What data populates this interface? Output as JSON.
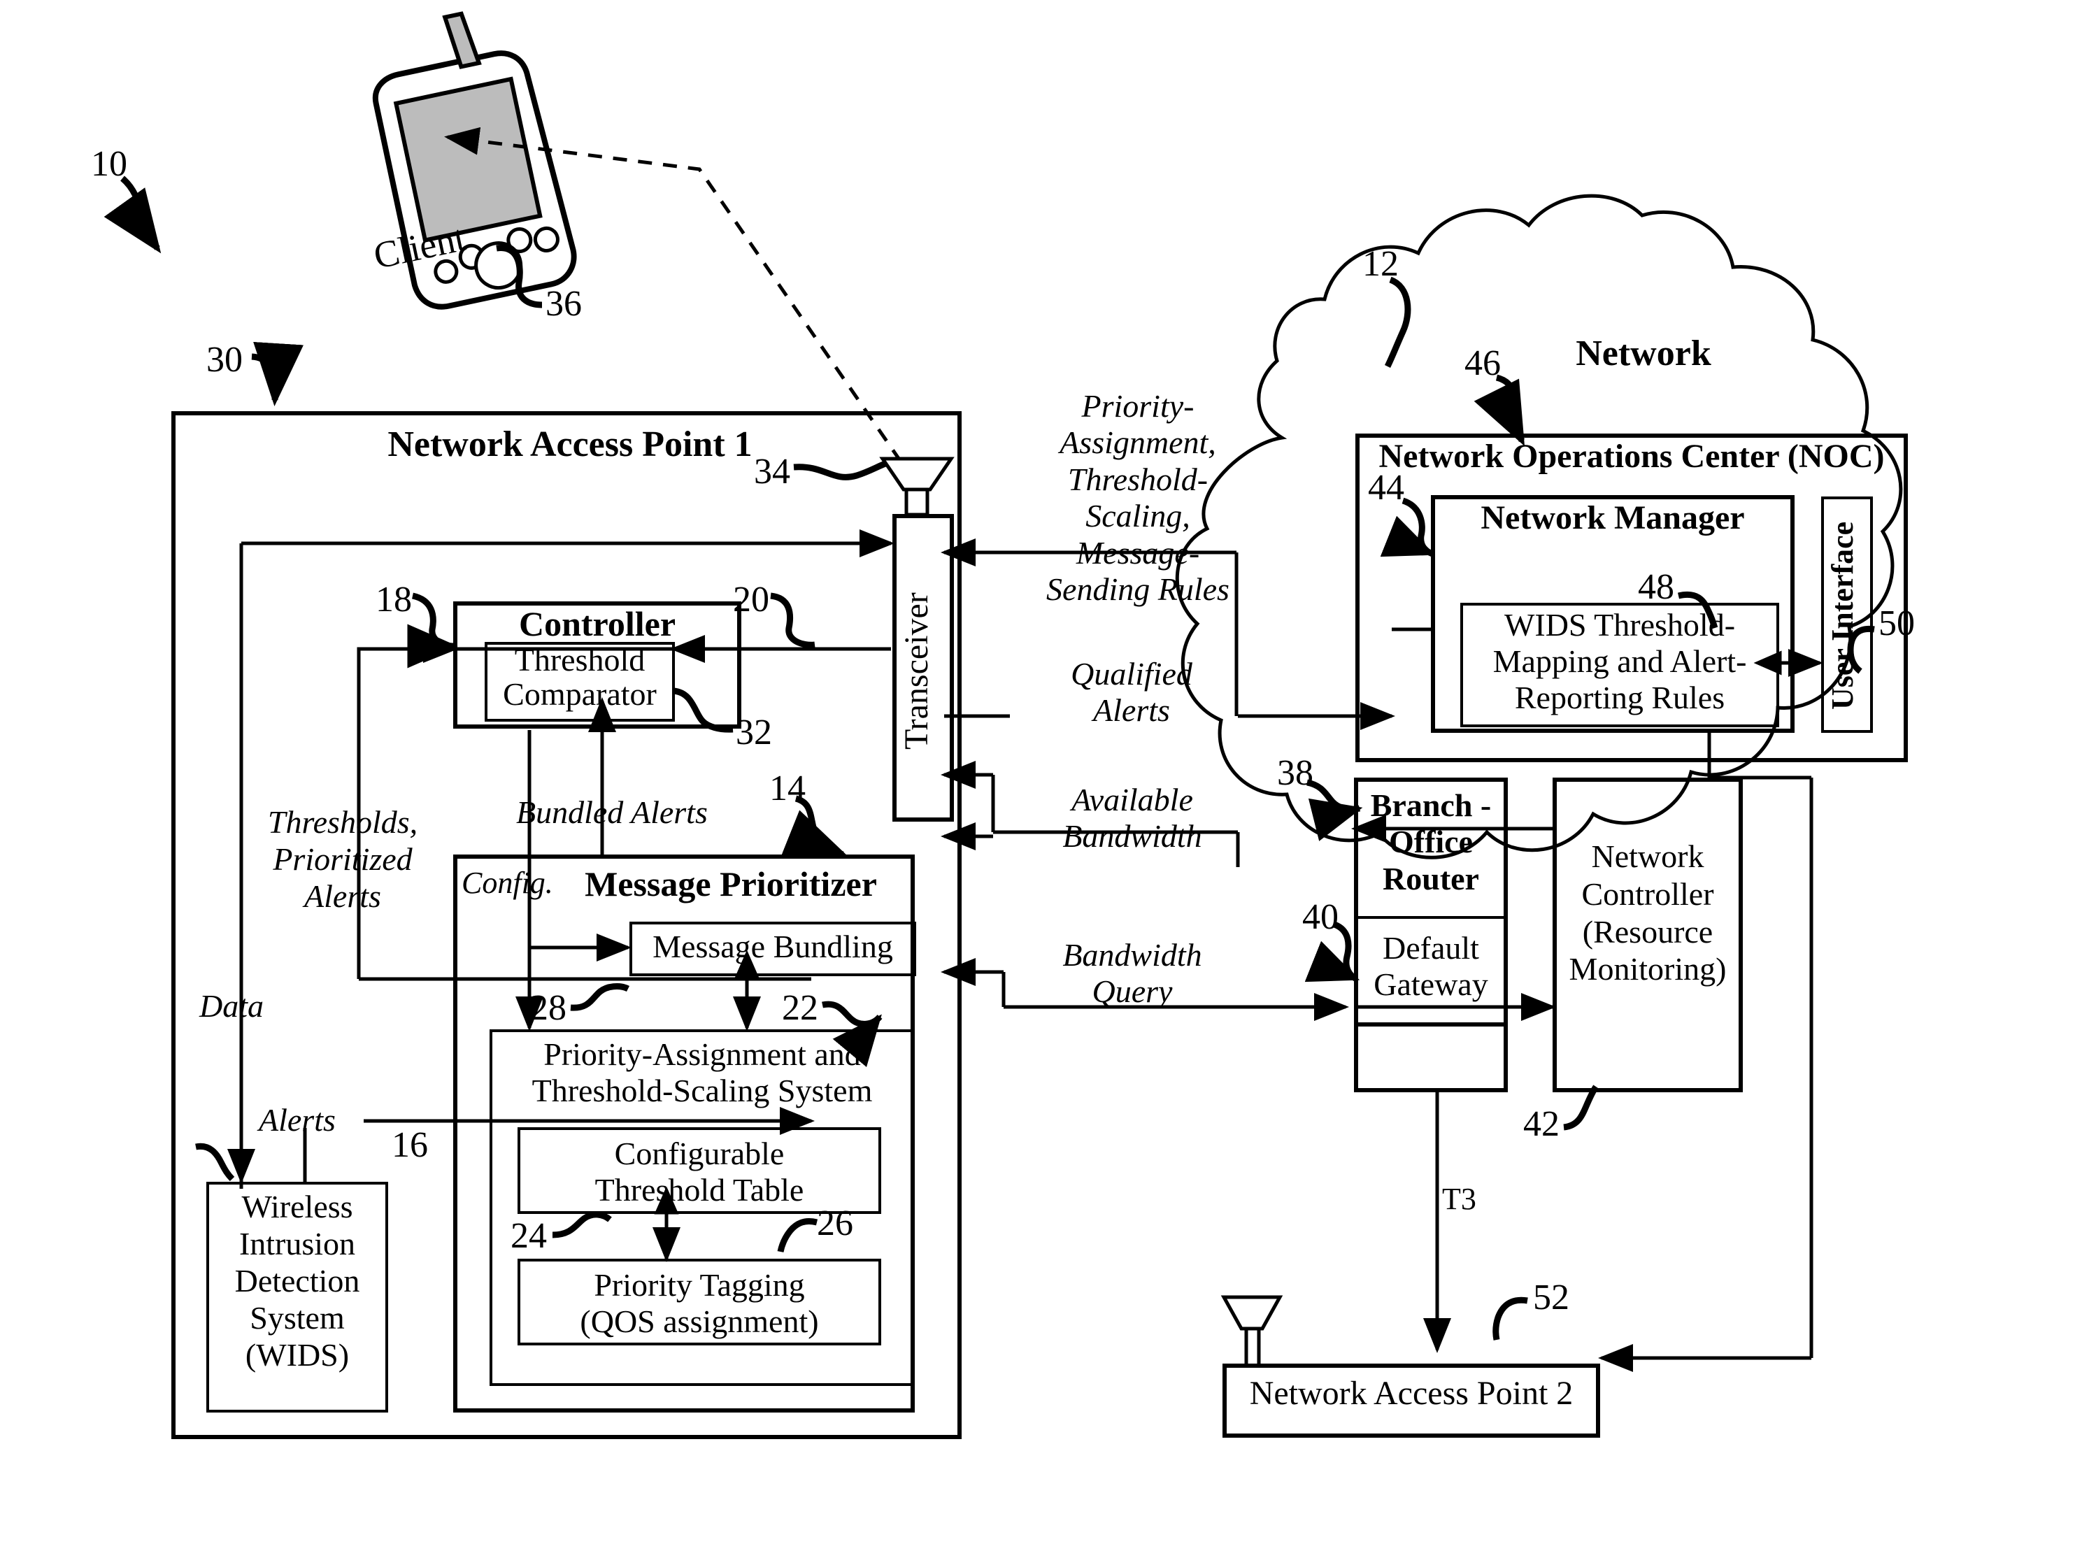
{
  "figure": {
    "main_ref": "10"
  },
  "client": {
    "screen_label": "Client",
    "ref": "36"
  },
  "nap1": {
    "title": "Network Access Point 1",
    "ref": "30",
    "antenna_ref": "34",
    "transceiver": {
      "label": "Transceiver",
      "ref": "20"
    },
    "controller": {
      "title": "Controller",
      "ref": "18",
      "threshold_comparator": {
        "label": "Threshold\nComparator",
        "line1": "Threshold",
        "line2": "Comparator",
        "ref": "32"
      }
    },
    "message_prioritizer": {
      "title": "Message Prioritizer",
      "ref": "14",
      "message_bundling": {
        "label": "Message Bundling",
        "ref": "28"
      },
      "pa_ts_system": {
        "line1": "Priority-Assignment and",
        "line2": "Threshold-Scaling System",
        "ref": "22",
        "configurable_threshold_table": {
          "line1": "Configurable",
          "line2": "Threshold Table",
          "ref": "24"
        },
        "priority_tagging": {
          "line1": "Priority Tagging",
          "line2": "(QOS assignment)",
          "ref": "26"
        }
      }
    },
    "wids": {
      "line1": "Wireless",
      "line2": "Intrusion",
      "line3": "Detection",
      "line4": "System",
      "line5": "(WIDS)",
      "ref": "16"
    },
    "flow_labels": {
      "thresholds_prioritized_alerts": "Thresholds,\nPrioritized\nAlerts",
      "tpa_l1": "Thresholds,",
      "tpa_l2": "Prioritized",
      "tpa_l3": "Alerts",
      "data": "Data",
      "alerts": "Alerts",
      "config": "Config.",
      "bundled_alerts": "Bundled Alerts"
    }
  },
  "link_labels": {
    "priority_rules_l1": "Priority-",
    "priority_rules_l2": "Assignment,",
    "priority_rules_l3": "Threshold-",
    "priority_rules_l4": "Scaling,",
    "priority_rules_l5": "Message-",
    "priority_rules_l6": "Sending Rules",
    "qualified_alerts_l1": "Qualified",
    "qualified_alerts_l2": "Alerts",
    "available_bandwidth_l1": "Available",
    "available_bandwidth_l2": "Bandwidth",
    "bandwidth_query_l1": "Bandwidth",
    "bandwidth_query_l2": "Query",
    "t3": "T3"
  },
  "network_cloud": {
    "label": "Network",
    "ref": "12"
  },
  "noc": {
    "title": "Network Operations Center (NOC)",
    "ref": "46",
    "network_manager": {
      "title": "Network Manager",
      "ref": "44",
      "wids_rules": {
        "line1": "WIDS Threshold-",
        "line2": "Mapping and Alert-",
        "line3": "Reporting Rules",
        "ref": "48"
      }
    },
    "user_interface": {
      "label": "User Interface",
      "ref": "50"
    }
  },
  "branch_router": {
    "line1": "Branch -",
    "line2": "Office",
    "line3": "Router",
    "ref": "38",
    "default_gateway": {
      "line1": "Default",
      "line2": "Gateway",
      "ref": "40"
    }
  },
  "network_controller": {
    "line1": "Network",
    "line2": "Controller",
    "line3": "(Resource",
    "line4": "Monitoring)",
    "ref": "42"
  },
  "nap2": {
    "label": "Network Access Point 2",
    "ref": "52"
  }
}
